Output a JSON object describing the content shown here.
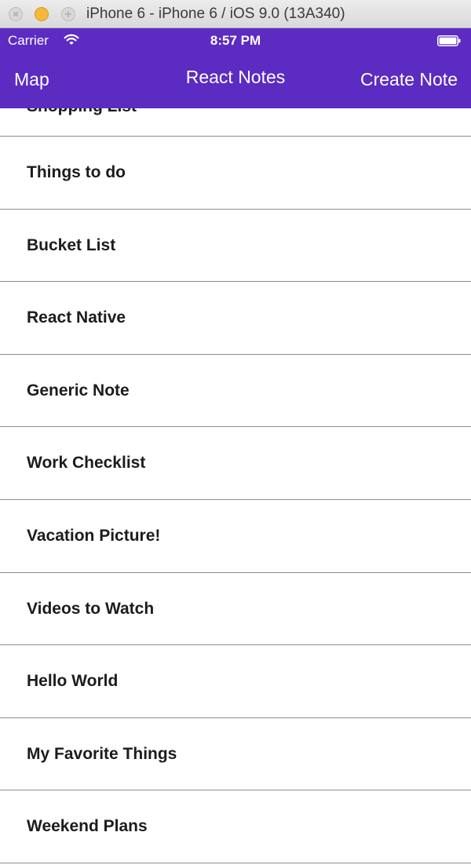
{
  "window": {
    "title": "iPhone 6 - iPhone 6 / iOS 9.0 (13A340)"
  },
  "status_bar": {
    "carrier": "Carrier",
    "time": "8:57 PM",
    "wifi_icon": "wifi-icon",
    "battery_icon": "battery-icon"
  },
  "nav": {
    "left_label": "Map",
    "title": "React Notes",
    "right_label": "Create Note"
  },
  "colors": {
    "nav_background": "#5b2bc2",
    "nav_text": "#ffffff",
    "separator": "#8d8d8d"
  },
  "notes": {
    "partial_item": "Shopping List",
    "items": [
      "Things to do",
      "Bucket List",
      "React Native",
      "Generic Note",
      "Work Checklist",
      "Vacation Picture!",
      "Videos to Watch",
      "Hello World",
      "My Favorite Things",
      "Weekend Plans"
    ]
  }
}
